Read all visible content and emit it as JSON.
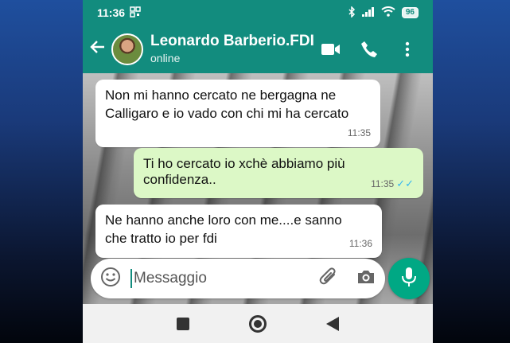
{
  "status_bar": {
    "time": "11:36",
    "battery": "96"
  },
  "header": {
    "contact_name": "Leonardo Barberio.FDI",
    "contact_status": "online"
  },
  "messages": [
    {
      "direction": "in",
      "text_lines": [
        "Non mi hanno cercato ne bergagna ne",
        "Calligaro e io vado con chi mi ha cercato"
      ],
      "time": "11:35"
    },
    {
      "direction": "out",
      "text_lines": [
        "Ti ho cercato io xchè abbiamo più",
        "confidenza.."
      ],
      "time": "11:35",
      "ticks": "✓✓"
    },
    {
      "direction": "in",
      "text_lines": [
        "Ne hanno anche loro con me....e sanno",
        "che tratto io per fdi"
      ],
      "time": "11:36"
    }
  ],
  "composer": {
    "placeholder": "Messaggio"
  },
  "icons": [
    "back-arrow-icon",
    "video-call-icon",
    "phone-icon",
    "more-options-icon",
    "emoji-icon",
    "attach-icon",
    "camera-icon",
    "mic-icon",
    "nav-recents-icon",
    "nav-home-icon",
    "nav-back-icon"
  ],
  "colors": {
    "header": "#128c7e",
    "outgoing_bubble": "#dcf8c6",
    "incoming_bubble": "#ffffff",
    "mic_button": "#00a884",
    "read_ticks": "#34b7f1"
  }
}
